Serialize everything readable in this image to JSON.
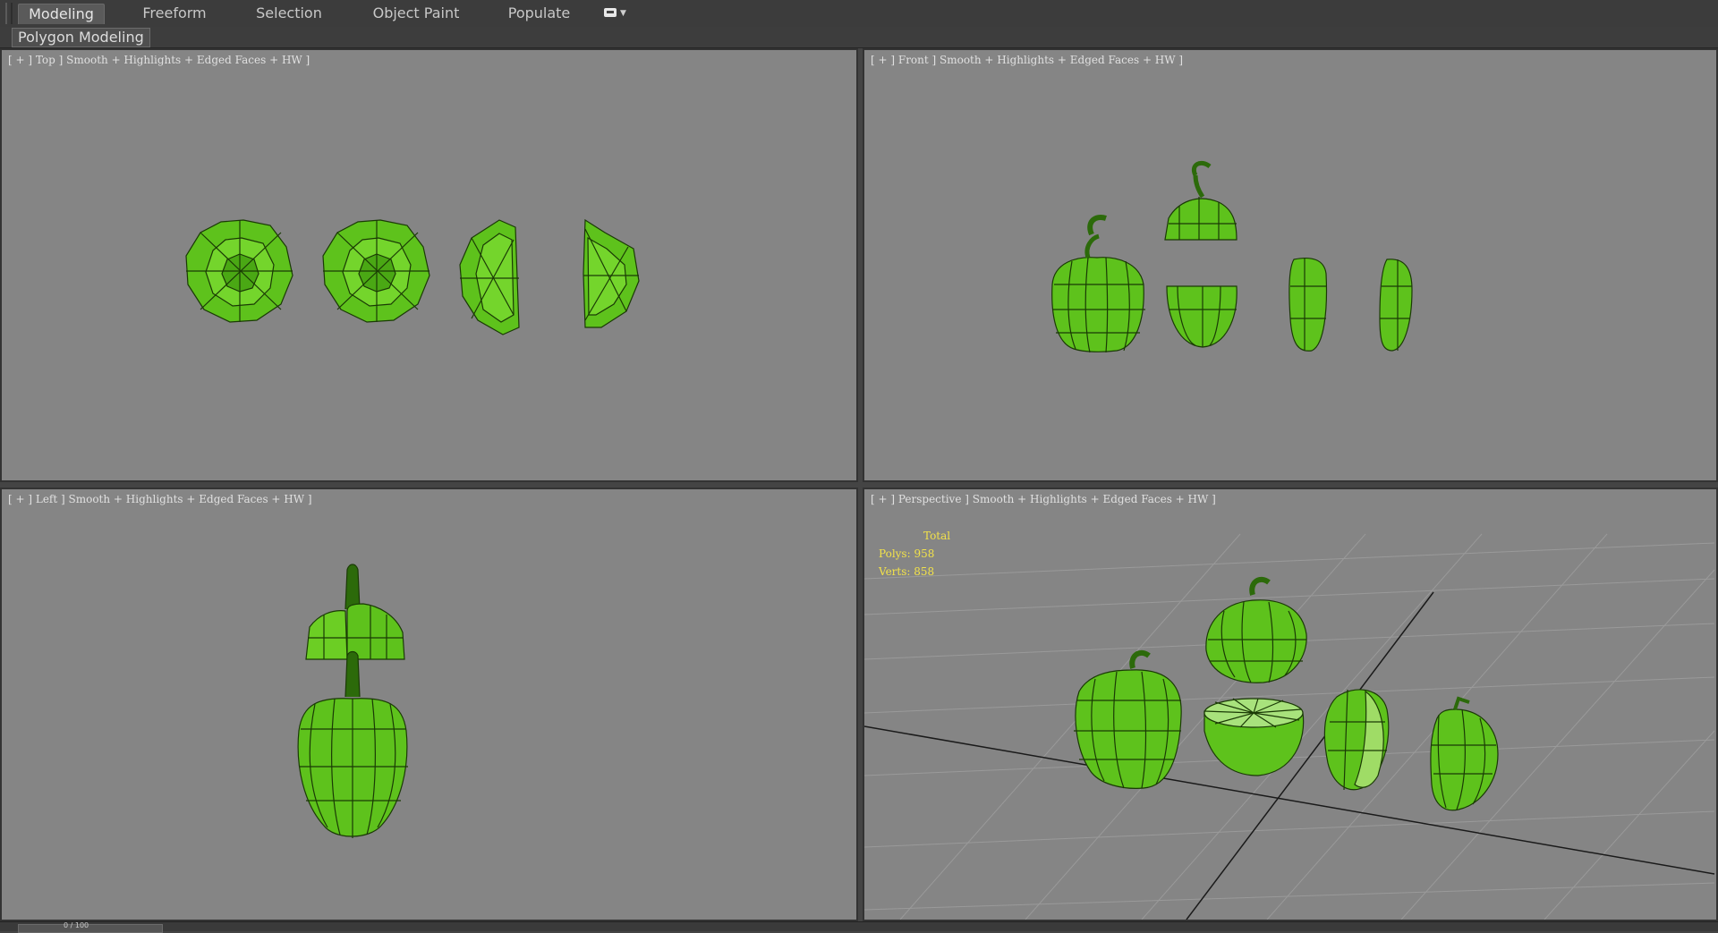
{
  "ribbon": {
    "tabs": [
      {
        "label": "Modeling",
        "active": true
      },
      {
        "label": "Freeform"
      },
      {
        "label": "Selection"
      },
      {
        "label": "Object Paint"
      },
      {
        "label": "Populate"
      }
    ],
    "panel_label": "Polygon Modeling"
  },
  "viewports": {
    "top": {
      "label": "[ + ] Top ] Smooth + Highlights + Edged Faces + HW ]"
    },
    "front": {
      "label": "[ + ] Front ] Smooth + Highlights + Edged Faces + HW ]"
    },
    "left": {
      "label": "[ + ] Left ] Smooth + Highlights + Edged Faces + HW ]"
    },
    "perspective": {
      "label": "[ + ] Perspective ] Smooth + Highlights + Edged Faces + HW ]",
      "stats": {
        "title": "Total",
        "polys": "Polys: 958",
        "verts": "Verts: 858"
      }
    }
  },
  "timeline": {
    "frame_text": "0 / 100"
  },
  "colors": {
    "viewport_bg": "#858585",
    "mesh_green": "#5ec21c",
    "mesh_edge": "#1a3a05",
    "stats_text": "#f2e24a",
    "ui_dark": "#3c3c3c"
  }
}
